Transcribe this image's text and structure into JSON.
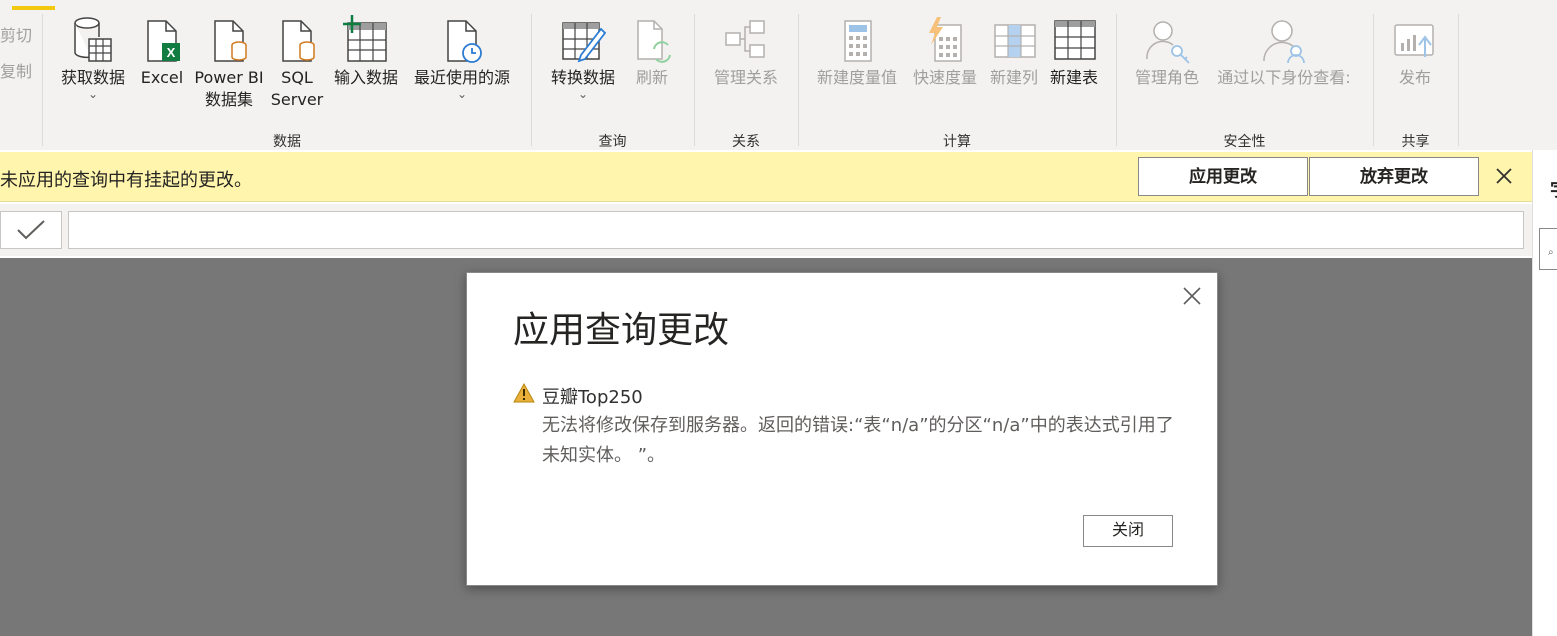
{
  "clipboard": {
    "cut_label": "剪切",
    "copy_label": "复制"
  },
  "ribbon": {
    "groups": {
      "data": "数据",
      "query": "查询",
      "relations": "关系",
      "calc": "计算",
      "security": "安全性",
      "share": "共享"
    },
    "buttons": {
      "get_data": "获取数据",
      "excel": "Excel",
      "powerbi_line1": "Power BI",
      "powerbi_line2": "数据集",
      "sql_line1": "SQL",
      "sql_line2": "Server",
      "enter_data": "输入数据",
      "recent_sources": "最近使用的源",
      "transform_data": "转换数据",
      "refresh": "刷新",
      "manage_relations": "管理关系",
      "new_measure": "新建度量值",
      "quick_measure": "快速度量",
      "new_column": "新建列",
      "new_table": "新建表",
      "manage_roles": "管理角色",
      "view_as": "通过以下身份查看:",
      "publish": "发布"
    },
    "chevron": "⌄"
  },
  "notification": {
    "text": "未应用的查询中有挂起的更改。",
    "apply_label": "应用更改",
    "discard_label": "放弃更改"
  },
  "right_pane": {
    "glyph": "字"
  },
  "dialog": {
    "title": "应用查询更改",
    "source": "豆瓣Top250",
    "message": "无法将修改保存到服务器。返回的错误:“表“n/a”的分区“n/a”中的表达式引用了未知实体。 ”。",
    "close_label": "关闭"
  },
  "colors": {
    "accent": "#f2c811",
    "notification_bg": "#fff5ac",
    "overlay": "#777777",
    "warning": "#c19c00"
  }
}
